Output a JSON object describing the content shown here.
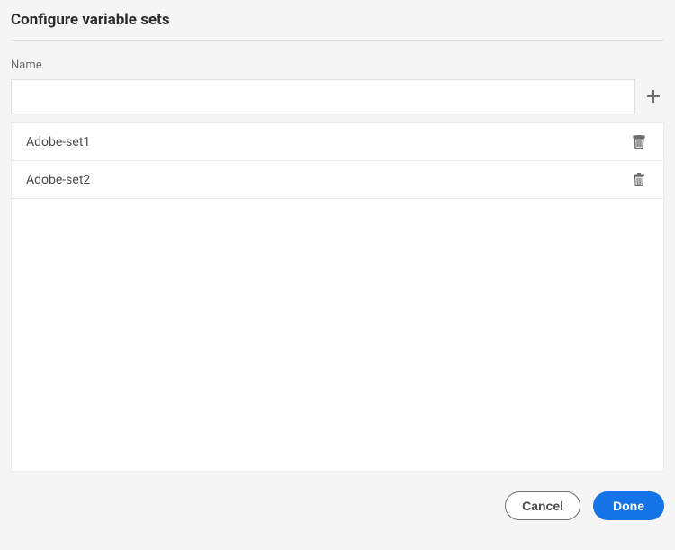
{
  "title": "Configure variable sets",
  "field_label": "Name",
  "name_input_value": "",
  "items": [
    {
      "label": "Adobe-set1"
    },
    {
      "label": "Adobe-set2"
    }
  ],
  "footer": {
    "cancel_label": "Cancel",
    "done_label": "Done"
  }
}
